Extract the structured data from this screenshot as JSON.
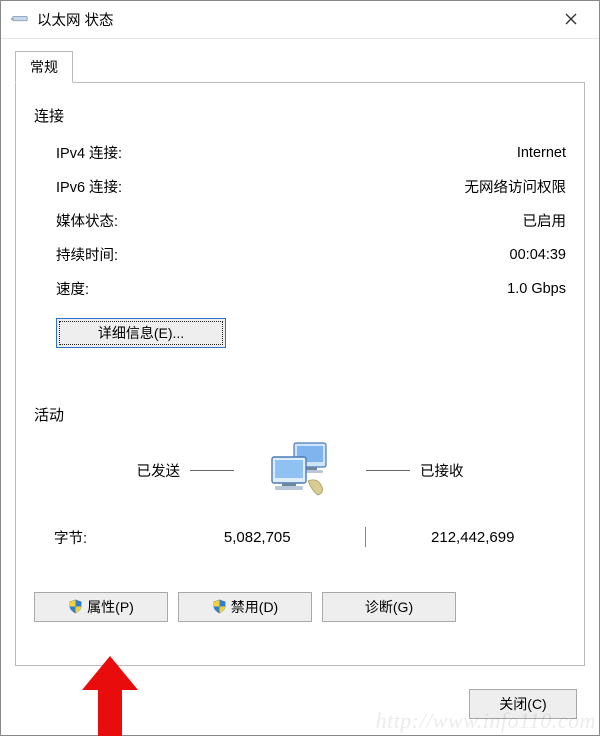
{
  "titlebar": {
    "title": "以太网 状态"
  },
  "tabs": {
    "general": "常规"
  },
  "connection": {
    "section_label": "连接",
    "rows": {
      "ipv4_label": "IPv4 连接:",
      "ipv4_value": "Internet",
      "ipv6_label": "IPv6 连接:",
      "ipv6_value": "无网络访问权限",
      "media_label": "媒体状态:",
      "media_value": "已启用",
      "duration_label": "持续时间:",
      "duration_value": "00:04:39",
      "speed_label": "速度:",
      "speed_value": "1.0 Gbps"
    },
    "details_button": "详细信息(E)..."
  },
  "activity": {
    "section_label": "活动",
    "sent_label": "已发送",
    "received_label": "已接收",
    "bytes_label": "字节:",
    "bytes_sent": "5,082,705",
    "bytes_received": "212,442,699"
  },
  "actions": {
    "properties": "属性(P)",
    "disable": "禁用(D)",
    "diagnose": "诊断(G)"
  },
  "footer": {
    "close": "关闭(C)"
  },
  "watermark": "http://www.info110.com"
}
